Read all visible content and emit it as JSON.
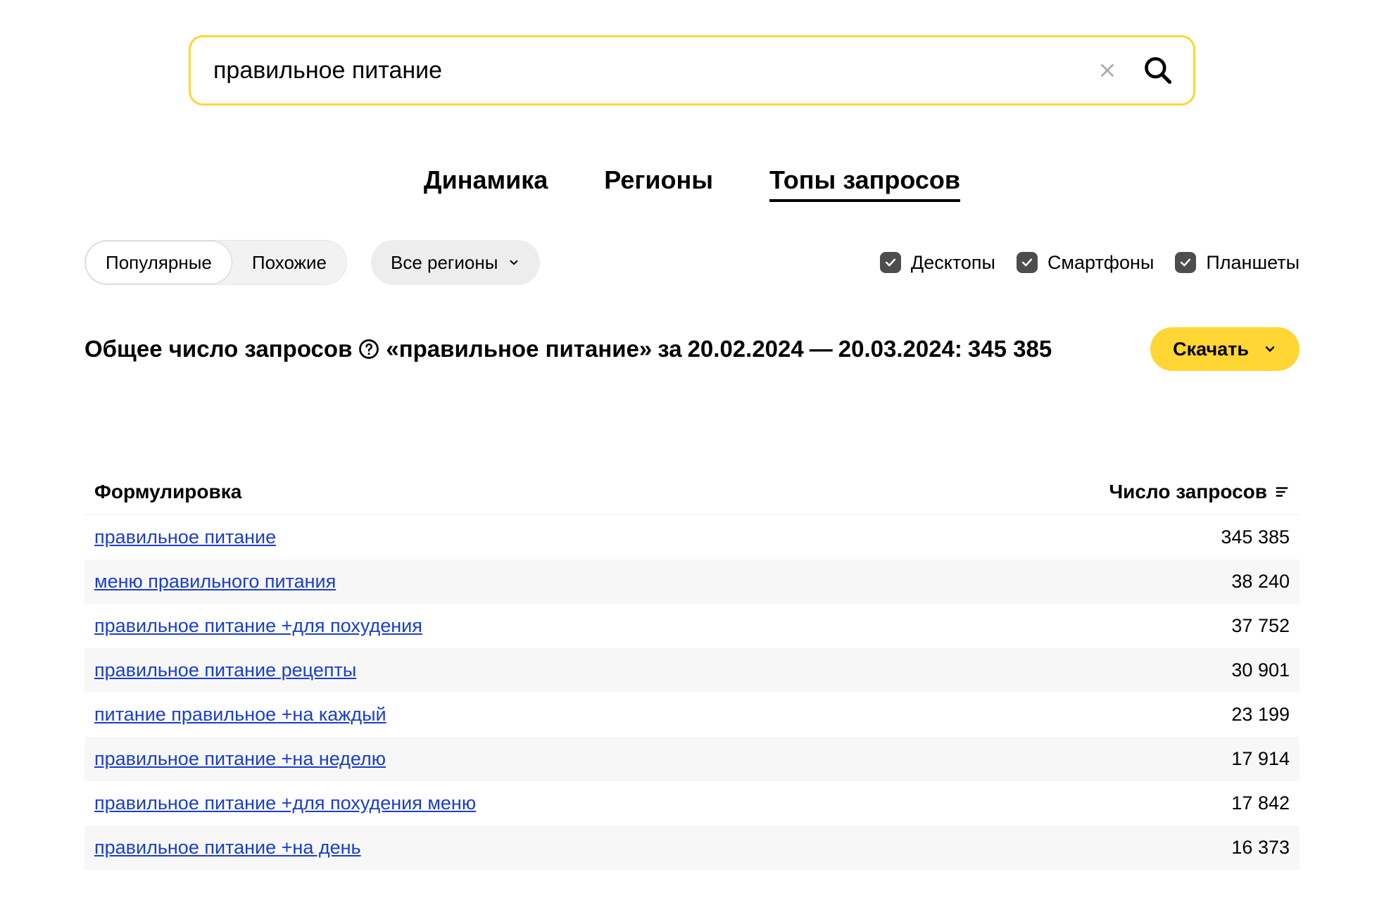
{
  "search": {
    "value": "правильное питание"
  },
  "tabs": {
    "items": [
      {
        "label": "Динамика",
        "active": false
      },
      {
        "label": "Регионы",
        "active": false
      },
      {
        "label": "Топы запросов",
        "active": true
      }
    ]
  },
  "segmented": {
    "items": [
      {
        "label": "Популярные",
        "active": true
      },
      {
        "label": "Похожие",
        "active": false
      }
    ]
  },
  "region_select": {
    "label": "Все регионы"
  },
  "devices": [
    {
      "label": "Десктопы",
      "checked": true
    },
    {
      "label": "Смартфоны",
      "checked": true
    },
    {
      "label": "Планшеты",
      "checked": true
    }
  ],
  "summary": {
    "prefix": "Общее число запросов",
    "query": "«правильное питание»",
    "period_prefix": "за",
    "date_from": "20.02.2024",
    "date_sep": "—",
    "date_to": "20.03.2024:",
    "total": "345 385"
  },
  "download": {
    "label": "Скачать"
  },
  "table": {
    "headers": {
      "left": "Формулировка",
      "right": "Число запросов"
    },
    "rows": [
      {
        "query": "правильное питание",
        "count": "345 385"
      },
      {
        "query": "меню правильного питания",
        "count": "38 240"
      },
      {
        "query": "правильное питание +для похудения",
        "count": "37 752"
      },
      {
        "query": "правильное питание рецепты",
        "count": "30 901"
      },
      {
        "query": "питание правильное +на каждый",
        "count": "23 199"
      },
      {
        "query": "правильное питание +на неделю",
        "count": "17 914"
      },
      {
        "query": "правильное питание +для похудения меню",
        "count": "17 842"
      },
      {
        "query": "правильное питание +на день",
        "count": "16 373"
      }
    ]
  }
}
